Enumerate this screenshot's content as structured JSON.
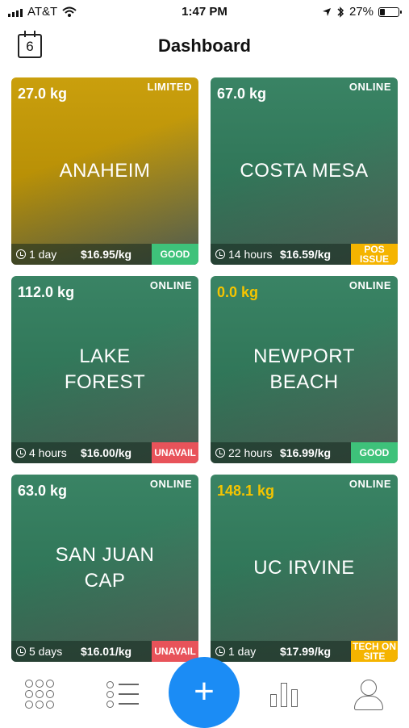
{
  "status": {
    "carrier": "AT&T",
    "time": "1:47 PM",
    "battery": "27%",
    "battery_level": 0.27
  },
  "header": {
    "calendar_day": "6",
    "title": "Dashboard"
  },
  "stations": [
    {
      "weight": "27.0 kg",
      "weight_color": "#ffffff",
      "state": "LIMITED",
      "name_lines": [
        "ANAHEIM"
      ],
      "since": "1 day",
      "price": "$16.95/kg",
      "badge": "GOOD",
      "badge_color": "#3ec27a",
      "tint": "#c79a00"
    },
    {
      "weight": "67.0 kg",
      "weight_color": "#ffffff",
      "state": "ONLINE",
      "name_lines": [
        "COSTA MESA"
      ],
      "since": "14 hours",
      "price": "$16.59/kg",
      "badge": "POS ISSUE",
      "badge_color": "#f5b400",
      "tint": "#2f7d5c"
    },
    {
      "weight": "112.0 kg",
      "weight_color": "#ffffff",
      "state": "ONLINE",
      "name_lines": [
        "LAKE",
        "FOREST"
      ],
      "since": "4 hours",
      "price": "$16.00/kg",
      "badge": "UNAVAIL",
      "badge_color": "#e8535a",
      "tint": "#2f7d5c"
    },
    {
      "weight": "0.0 kg",
      "weight_color": "#f5c400",
      "state": "ONLINE",
      "name_lines": [
        "NEWPORT",
        "BEACH"
      ],
      "since": "22 hours",
      "price": "$16.99/kg",
      "badge": "GOOD",
      "badge_color": "#3ec27a",
      "tint": "#2f7d5c"
    },
    {
      "weight": "63.0 kg",
      "weight_color": "#ffffff",
      "state": "ONLINE",
      "name_lines": [
        "SAN JUAN",
        "CAP"
      ],
      "since": "5 days",
      "price": "$16.01/kg",
      "badge": "UNAVAIL",
      "badge_color": "#e8535a",
      "tint": "#2f7d5c"
    },
    {
      "weight": "148.1 kg",
      "weight_color": "#f5c400",
      "state": "ONLINE",
      "name_lines": [
        "UC IRVINE"
      ],
      "since": "1 day",
      "price": "$17.99/kg",
      "badge": "TECH ON SITE",
      "badge_color": "#f5b400",
      "tint": "#2f7d5c"
    }
  ],
  "nav": {
    "items": [
      "grid-icon",
      "list-icon",
      "plus-icon",
      "bar-chart-icon",
      "profile-icon"
    ],
    "plus_label": "+",
    "accent": "#1b8cf5"
  }
}
